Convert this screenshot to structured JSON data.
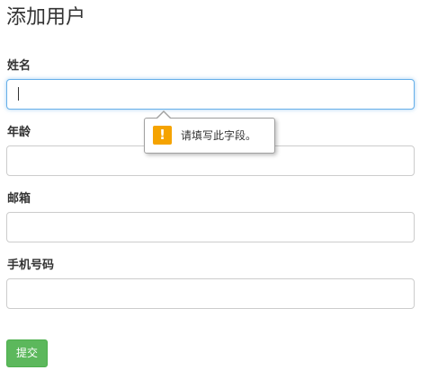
{
  "page": {
    "title": "添加用户"
  },
  "form": {
    "fields": [
      {
        "label": "姓名",
        "value": "",
        "focused": true
      },
      {
        "label": "年龄",
        "value": ""
      },
      {
        "label": "邮箱",
        "value": ""
      },
      {
        "label": "手机号码",
        "value": ""
      }
    ],
    "submit_label": "提交"
  },
  "validation_tooltip": {
    "icon": "warning-icon",
    "icon_glyph": "!",
    "message": "请填写此字段。"
  },
  "colors": {
    "focus_border": "#66afe9",
    "submit_bg": "#5cb85c",
    "warning_icon_bg": "#f5a300"
  }
}
